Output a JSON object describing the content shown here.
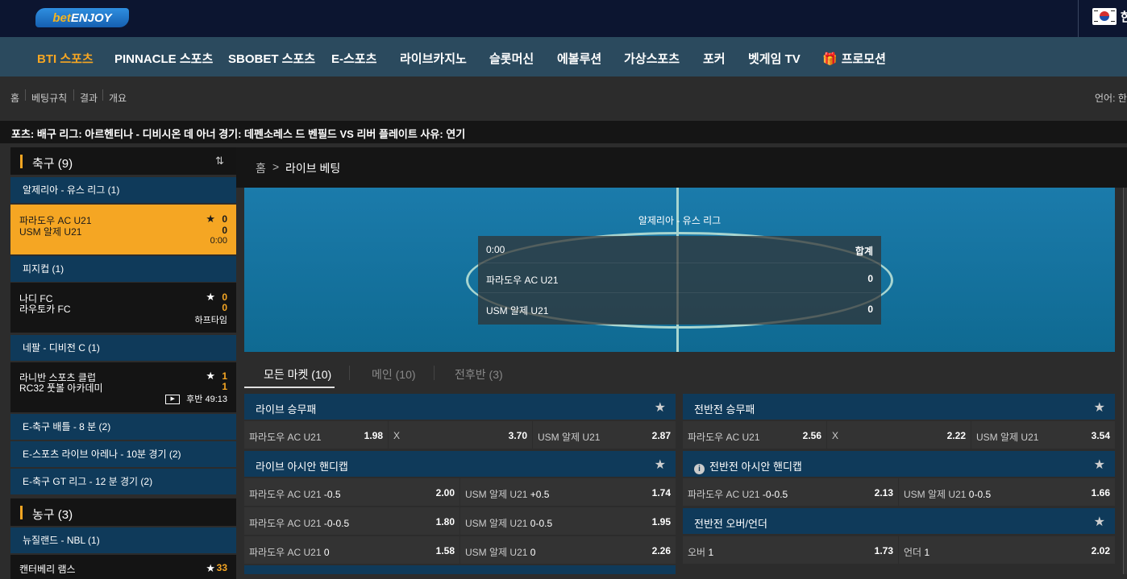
{
  "brand": {
    "logo_text_a": "bet",
    "logo_text_b": "ENJOY"
  },
  "lang_flag": "korea-flag",
  "top_lang_label": "한",
  "nav": [
    {
      "label": "BTI 스포츠",
      "active": true
    },
    {
      "label": "PINNACLE 스포츠"
    },
    {
      "label": "SBOBET 스포츠"
    },
    {
      "label": "E-스포츠"
    },
    {
      "label": "라이브카지노"
    },
    {
      "label": "슬롯머신"
    },
    {
      "label": "에볼루션"
    },
    {
      "label": "가상스포츠"
    },
    {
      "label": "포커"
    },
    {
      "label": "벳게임 TV"
    },
    {
      "label": "프로모션",
      "icon": "gift-icon"
    }
  ],
  "breadcrumb": [
    "홈",
    "베팅규칙",
    "결과",
    "개요"
  ],
  "language_label": "언어: 한",
  "ticker_text": "포츠: 배구 리그: 아르헨티나 - 디비시온 데 아너 경기: 데펜소레스 드 벤필드 VS 리버 플레이트 사유: 연기",
  "sidebar": {
    "soccer": {
      "title": "축구 (9)"
    },
    "leagues": [
      {
        "label": "알제리아 - 유스 리그 (1)"
      },
      {
        "label": "피지컵 (1)"
      },
      {
        "label": "네팔 - 디비전 C (1)"
      },
      {
        "label": "E-축구 배틀 - 8 분 (2)"
      },
      {
        "label": "E-스포츠 라이브 아레나 - 10분 경기 (2)"
      },
      {
        "label": "E-축구 GT 리그 - 12 분 경기 (2)"
      },
      {
        "label": "뉴질랜드 - NBL (1)"
      }
    ],
    "matches": [
      {
        "home": "파라도우 AC U21",
        "away": "USM 알제 U21",
        "home_score": "0",
        "away_score": "0",
        "status": "0:00",
        "selected": true
      },
      {
        "home": "나디 FC",
        "away": "라우토카 FC",
        "home_score": "0",
        "away_score": "0",
        "status": "하프타임"
      },
      {
        "home": "라니반 스포츠 클럽",
        "away": "RC32 풋볼 아카데미",
        "home_score": "1",
        "away_score": "1",
        "status": "후반 49:13"
      },
      {
        "home": "캔터베리 램스",
        "home_score": "33"
      }
    ],
    "basketball": {
      "title": "농구 (3)"
    }
  },
  "main": {
    "crumb_home": "홈",
    "crumb_sep": ">",
    "crumb_current": "라이브 베팅",
    "field_league": "알제리아 - 유스 리그",
    "score_time": "0:00",
    "score_total_label": "합계",
    "score_home": "파라도우 AC U21",
    "score_away": "USM 알제 U21",
    "score_home_val": "0",
    "score_away_val": "0"
  },
  "tabs": [
    {
      "label": "모든 마켓 (10)",
      "active": true
    },
    {
      "label": "메인 (10)"
    },
    {
      "label": "전후반 (3)"
    }
  ],
  "markets": {
    "live_1x2": {
      "title": "라이브 승무패",
      "odds": [
        {
          "name": "파라도우 AC U21",
          "value": "1.98"
        },
        {
          "name": "X",
          "value": "3.70"
        },
        {
          "name": "USM 알제 U21",
          "value": "2.87"
        }
      ]
    },
    "ht_1x2": {
      "title": "전반전 승무패",
      "odds": [
        {
          "name": "파라도우 AC U21",
          "value": "2.56"
        },
        {
          "name": "X",
          "value": "2.22"
        },
        {
          "name": "USM 알제 U21",
          "value": "3.54"
        }
      ]
    },
    "live_ah": {
      "title": "라이브 아시안 핸디캡",
      "rows": [
        [
          {
            "name": "파라도우 AC U21",
            "line": "-0.5",
            "value": "2.00"
          },
          {
            "name": "USM 알제 U21",
            "line": "+0.5",
            "value": "1.74"
          }
        ],
        [
          {
            "name": "파라도우 AC U21",
            "line": "-0-0.5",
            "value": "1.80"
          },
          {
            "name": "USM 알제 U21",
            "line": "0-0.5",
            "value": "1.95"
          }
        ],
        [
          {
            "name": "파라도우 AC U21",
            "line": "0",
            "value": "1.58"
          },
          {
            "name": "USM 알제 U21",
            "line": "0",
            "value": "2.26"
          }
        ]
      ]
    },
    "ht_ah": {
      "title": "전반전 아시안 핸디캡",
      "odds": [
        {
          "name": "파라도우 AC U21",
          "line": "-0-0.5",
          "value": "2.13"
        },
        {
          "name": "USM 알제 U21",
          "line": "0-0.5",
          "value": "1.66"
        }
      ]
    },
    "ht_ou": {
      "title": "전반전 오버/언더",
      "odds": [
        {
          "name": "오버",
          "line": "1",
          "value": "1.73"
        },
        {
          "name": "언더",
          "line": "1",
          "value": "2.02"
        }
      ]
    }
  }
}
